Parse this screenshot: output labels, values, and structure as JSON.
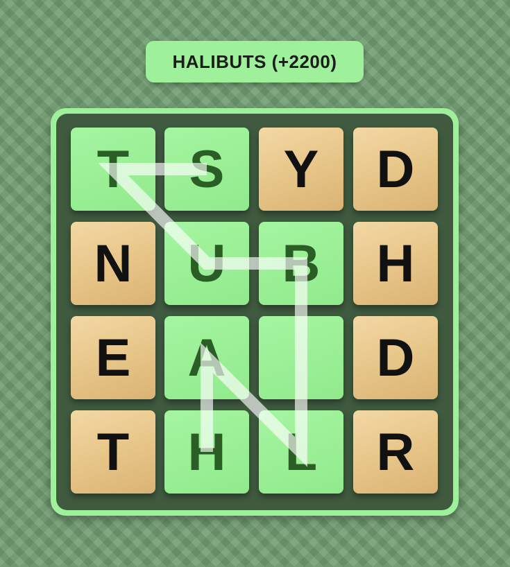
{
  "found_word": "HALIBUTS (+2200)",
  "grid": {
    "rows": 4,
    "cols": 4,
    "tiles": [
      [
        "T",
        "S",
        "Y",
        "D"
      ],
      [
        "N",
        "U",
        "B",
        "H"
      ],
      [
        "E",
        "A",
        "",
        "D"
      ],
      [
        "T",
        "H",
        "L",
        "R"
      ]
    ],
    "selected": [
      [
        true,
        true,
        false,
        false
      ],
      [
        false,
        true,
        true,
        false
      ],
      [
        false,
        true,
        true,
        false
      ],
      [
        false,
        true,
        true,
        false
      ]
    ]
  },
  "trace_path": [
    [
      3,
      1
    ],
    [
      2,
      1
    ],
    [
      3,
      2
    ],
    [
      1,
      2
    ],
    [
      1,
      1
    ],
    [
      0,
      0
    ],
    [
      0,
      1
    ]
  ],
  "colors": {
    "highlight": "#9ef09a",
    "board_dark": "#3f5a3f",
    "wood": "#e6c487",
    "lit_letter": "#2a5e24",
    "path": "#ffffff"
  }
}
